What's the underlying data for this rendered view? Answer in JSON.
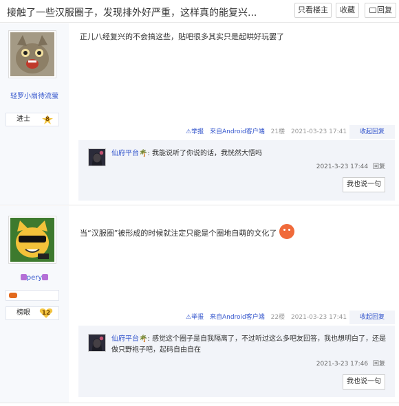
{
  "header": {
    "title": "接触了一些汉服圈子，发现排外好严重，这样真的能复兴...",
    "only_host_label": "只看楼主",
    "favorite_label": "收藏",
    "reply_label": "回复"
  },
  "posts": [
    {
      "username": "轻罗小扇待流萤",
      "level_name": "进士",
      "level_num": "8",
      "content": "正儿八经复兴的不会搞这些，贴吧很多其实只是起哄好玩罢了",
      "report_label": "⚠举报",
      "client_label": "来自Android客户端",
      "floor": "21楼",
      "time": "2021-03-23 17:41",
      "collapse_label": "收起回复",
      "reply": {
        "user": "仙府平台",
        "colon": ":",
        "text": "我能说听了你说的话，我恍然大悟吗",
        "time": "2021-3-23 17:44",
        "reply_label": "回复"
      },
      "say_label": "我也说一句"
    },
    {
      "username": "pery",
      "level_name": "榜眼",
      "level_num": "12",
      "content": "当“汉服圈”被形成的时候就注定只能是个圈地自萌的文化了",
      "report_label": "⚠举报",
      "client_label": "来自Android客户端",
      "floor": "22楼",
      "time": "2021-03-23 17:41",
      "collapse_label": "收起回复",
      "reply": {
        "user": "仙府平台",
        "colon": ":",
        "text": "感觉这个圈子是自我隔离了，不过听过这么多吧友回答，我也想明白了，还是做只野袍子吧，起码自由自在",
        "time": "2021-3-23 17:46",
        "reply_label": "回复"
      },
      "say_label": "我也说一句"
    }
  ],
  "colors": {
    "link": "#3355cc",
    "sidebar": "#f7f9fc",
    "reply_bg": "#f2f4f9"
  }
}
